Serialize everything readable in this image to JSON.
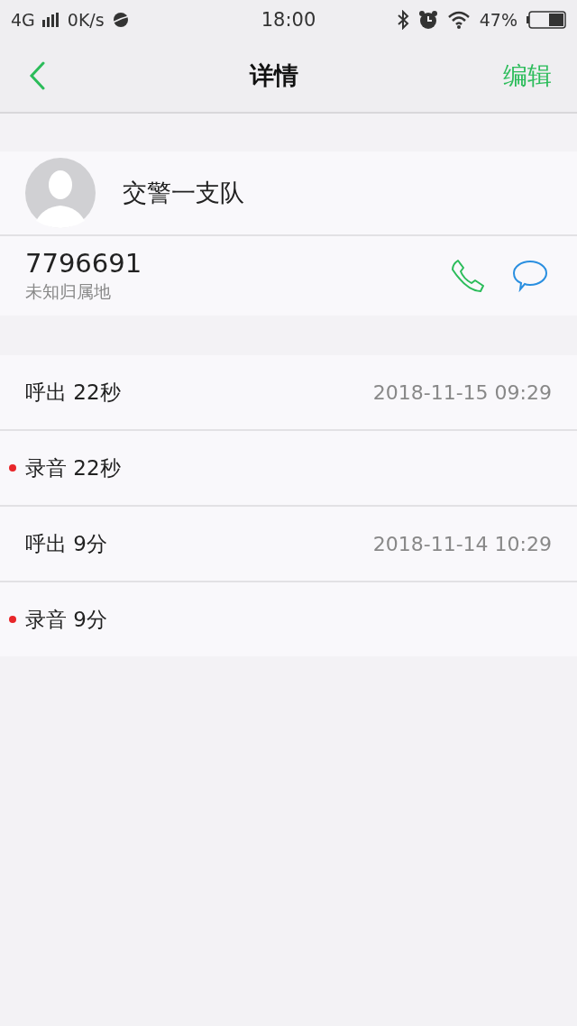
{
  "status_bar": {
    "network": "4G",
    "speed": "0K/s",
    "time": "18:00",
    "battery": "47%"
  },
  "nav": {
    "title": "详情",
    "action": "编辑"
  },
  "contact": {
    "name": "交警一支队",
    "number": "7796691",
    "location": "未知归属地"
  },
  "log": [
    {
      "kind": "call",
      "label": "呼出 22秒",
      "time": "2018-11-15 09:29"
    },
    {
      "kind": "recording",
      "label": "录音 22秒"
    },
    {
      "kind": "call",
      "label": "呼出 9分",
      "time": "2018-11-14 10:29"
    },
    {
      "kind": "recording",
      "label": "录音 9分"
    }
  ]
}
